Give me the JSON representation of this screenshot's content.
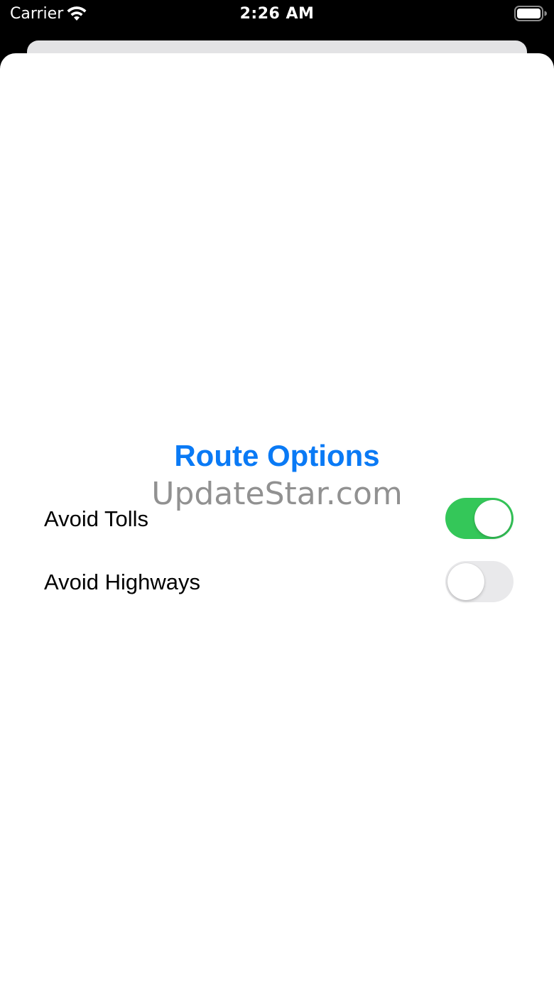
{
  "status_bar": {
    "carrier": "Carrier",
    "time": "2:26 AM",
    "wifi_icon": "wifi-icon",
    "battery_icon": "battery-icon"
  },
  "sheet": {
    "title": "Route Options",
    "title_color": "#0a7af5",
    "watermark": "UpdateStar.com",
    "options": [
      {
        "label": "Avoid Tolls",
        "on": true
      },
      {
        "label": "Avoid Highways",
        "on": false
      }
    ],
    "toggle_on_color": "#34c759",
    "toggle_off_color": "#e9e9eb"
  }
}
